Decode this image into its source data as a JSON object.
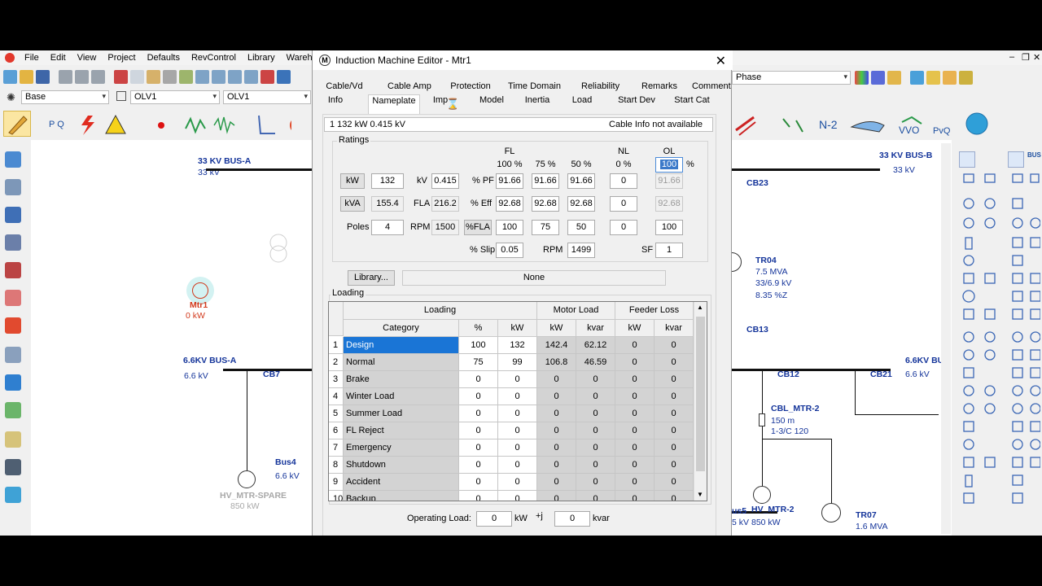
{
  "app": {
    "menu": [
      "File",
      "Edit",
      "View",
      "Project",
      "Defaults",
      "RevControl",
      "Library",
      "Wareh"
    ],
    "toolbar": {
      "combo_mode": "Base",
      "combo_olv1": "OLV1",
      "combo_olv2": "OLV1",
      "combo_phase": "Phase",
      "sc_label": "N-2",
      "vvo_label": "VVO",
      "pvq_label": "PvQ"
    }
  },
  "canvas": {
    "left": {
      "bus_a": {
        "name": "33 KV BUS-A",
        "kv": "33 kV"
      },
      "motor": {
        "name": "Mtr1",
        "kw": "0 kW"
      },
      "bus_66": {
        "name": "6.6KV BUS-A",
        "kv": "6.6 kV"
      },
      "cb7": "CB7",
      "bus4": {
        "name": "Bus4",
        "kv": "6.6 kV"
      },
      "hv_spare": {
        "name": "HV_MTR-SPARE",
        "kw": "850 kW"
      }
    },
    "right": {
      "bus_b": {
        "name": "33 KV BUS-B",
        "kv": "33 kV"
      },
      "cb23": "CB23",
      "tr04": {
        "name": "TR04",
        "mva": "7.5 MVA",
        "kv": "33/6.9 kV",
        "z": "8.35 %Z"
      },
      "cb13": "CB13",
      "bus_66b": {
        "name": "6.6KV BU",
        "kv": "6.6 kV"
      },
      "cb12": "CB12",
      "cb21": "CB21",
      "cbl": {
        "name": "CBL_MTR-2",
        "len": "150 m",
        "size": "1-3/C 120"
      },
      "bus5": {
        "name": "us5",
        "kv": "5 kV"
      },
      "hv_mtr2": {
        "name": "HV_MTR-2",
        "kw": "850 kW"
      },
      "tr07": {
        "name": "TR07",
        "mva": "1.6 MVA"
      }
    }
  },
  "dialog": {
    "title": "Induction Machine Editor - Mtr1",
    "icon_letter": "M",
    "tabs_row1": [
      "Cable/Vd",
      "Cable Amp",
      "Protection",
      "Time Domain",
      "Reliability",
      "Remarks",
      "Comment"
    ],
    "tabs_row2": [
      "Info",
      "Nameplate",
      "Imp",
      "Model",
      "Inertia",
      "Load",
      "Start Dev",
      "Start Cat"
    ],
    "active_tab": "Nameplate",
    "info": {
      "left": "1   132 kW  0.415 kV",
      "right": "Cable Info not available"
    },
    "ratings": {
      "label": "Ratings",
      "fl_header": "FL",
      "nl_header": "NL",
      "ol_header": "OL",
      "col_heads": [
        "100 %",
        "75 %",
        "50 %",
        "0 %"
      ],
      "pct": "%",
      "kw_btn": "kW",
      "kw_val": "132",
      "kv_lbl": "kV",
      "kv_val": "0.415",
      "kva_btn": "kVA",
      "kva_val": "155.4",
      "fla_lbl": "FLA",
      "fla_val": "216.2",
      "poles_lbl": "Poles",
      "poles_val": "4",
      "rpm_lbl": "RPM",
      "rpm_val": "1500",
      "pf_lbl": "% PF",
      "pf": [
        "91.66",
        "91.66",
        "91.66",
        "0",
        "91.66"
      ],
      "eff_lbl": "% Eff",
      "eff": [
        "92.68",
        "92.68",
        "92.68",
        "0",
        "92.68"
      ],
      "fla_btn": "%FLA",
      "flap": [
        "100",
        "75",
        "50",
        "0",
        "100"
      ],
      "ol_val": "100",
      "slip_lbl": "% Slip",
      "slip_val": "0.05",
      "rpm2_lbl": "RPM",
      "rpm2_val": "1499",
      "sf_lbl": "SF",
      "sf_val": "1"
    },
    "library": {
      "button": "Library...",
      "value": "None"
    },
    "loading": {
      "label": "Loading",
      "group_loading": "Loading",
      "group_motor": "Motor Load",
      "group_feeder": "Feeder Loss",
      "cols": [
        "Category",
        "%",
        "kW",
        "kW",
        "kvar",
        "kW",
        "kvar"
      ],
      "rows": [
        {
          "n": "1",
          "cat": "Design",
          "pct": "100",
          "kw": "132",
          "mkw": "142.4",
          "mkvar": "62.12",
          "fkw": "0",
          "fkvar": "0"
        },
        {
          "n": "2",
          "cat": "Normal",
          "pct": "75",
          "kw": "99",
          "mkw": "106.8",
          "mkvar": "46.59",
          "fkw": "0",
          "fkvar": "0"
        },
        {
          "n": "3",
          "cat": "Brake",
          "pct": "0",
          "kw": "0",
          "mkw": "0",
          "mkvar": "0",
          "fkw": "0",
          "fkvar": "0"
        },
        {
          "n": "4",
          "cat": "Winter Load",
          "pct": "0",
          "kw": "0",
          "mkw": "0",
          "mkvar": "0",
          "fkw": "0",
          "fkvar": "0"
        },
        {
          "n": "5",
          "cat": "Summer Load",
          "pct": "0",
          "kw": "0",
          "mkw": "0",
          "mkvar": "0",
          "fkw": "0",
          "fkvar": "0"
        },
        {
          "n": "6",
          "cat": "FL Reject",
          "pct": "0",
          "kw": "0",
          "mkw": "0",
          "mkvar": "0",
          "fkw": "0",
          "fkvar": "0"
        },
        {
          "n": "7",
          "cat": "Emergency",
          "pct": "0",
          "kw": "0",
          "mkw": "0",
          "mkvar": "0",
          "fkw": "0",
          "fkvar": "0"
        },
        {
          "n": "8",
          "cat": "Shutdown",
          "pct": "0",
          "kw": "0",
          "mkw": "0",
          "mkvar": "0",
          "fkw": "0",
          "fkvar": "0"
        },
        {
          "n": "9",
          "cat": "Accident",
          "pct": "0",
          "kw": "0",
          "mkw": "0",
          "mkvar": "0",
          "fkw": "0",
          "fkvar": "0"
        },
        {
          "n": "10",
          "cat": "Backup",
          "pct": "0",
          "kw": "0",
          "mkw": "0",
          "mkvar": "0",
          "fkw": "0",
          "fkvar": "0"
        }
      ]
    },
    "operating": {
      "label": "Operating Load:",
      "kw": "0",
      "kw_unit": "kW",
      "j": "+j",
      "kvar": "0",
      "kvar_unit": "kvar"
    }
  }
}
